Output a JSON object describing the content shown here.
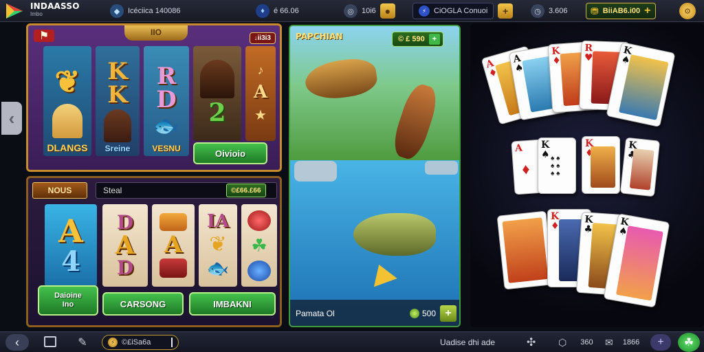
{
  "topbar": {
    "brand_title": "INDAASSO",
    "brand_sub": "Imbo",
    "stat1": "Icéciica 140086",
    "stat2": "é 66.06",
    "stat3": "10i6",
    "stat4": "CiOGLA Conuoi",
    "stat5": "3.606",
    "balance": "BiiAB6.i00",
    "plus": "+"
  },
  "slot_top": {
    "badge": "IIO",
    "corner": "↓ii3i3",
    "reel1_label": "DLANGS",
    "reel2_label": "Sreine",
    "reel3_label": "VESNU",
    "button": "Oivioio"
  },
  "slot_bottom": {
    "tag": "NOUS",
    "field": "Steal",
    "counter": "©£66.£66",
    "btn_left_line1": "Daioine",
    "btn_left_line2": "Ino",
    "btn_mid": "CARSONG",
    "btn_right": "IMBAKNI"
  },
  "fish_game": {
    "title": "PAPCHIAN",
    "coins": "© £ 590",
    "footer_label": "Pamata Ol",
    "footer_value": "500",
    "plus": "+"
  },
  "bottombar": {
    "counter": "©£iSa6a",
    "status": "Uadise dhi ade",
    "val1": "360",
    "val2": "1866"
  },
  "colors": {
    "accent_gold": "#d5b03b",
    "accent_green": "#3fb848",
    "panel_purple": "#4a2669"
  }
}
